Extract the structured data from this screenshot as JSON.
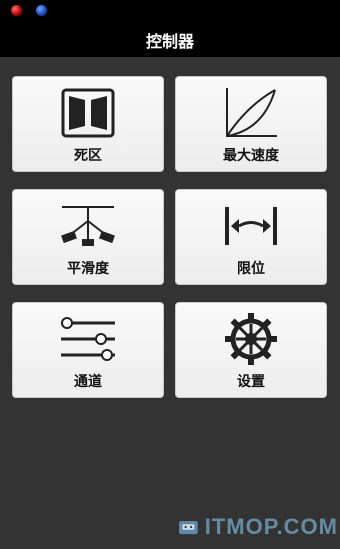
{
  "header": {
    "title": "控制器"
  },
  "tiles": [
    {
      "label": "死区",
      "icon": "deadzone-icon"
    },
    {
      "label": "最大速度",
      "icon": "max-speed-curve-icon"
    },
    {
      "label": "平滑度",
      "icon": "smoothness-icon"
    },
    {
      "label": "限位",
      "icon": "limit-icon"
    },
    {
      "label": "通道",
      "icon": "channel-sliders-icon"
    },
    {
      "label": "设置",
      "icon": "gear-icon"
    }
  ],
  "watermark": {
    "text": "ITMOP.COM"
  },
  "colors": {
    "background": "#333333",
    "title_bar": "#000000",
    "tile": "#f5f5f5"
  }
}
